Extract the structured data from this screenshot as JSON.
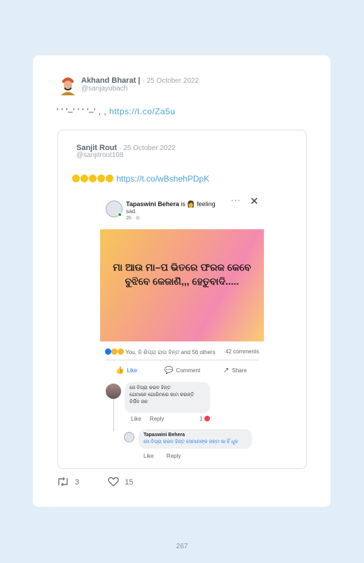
{
  "tweet": {
    "author_name": "Akhand Bharat |",
    "date": "· 25 October 2022",
    "handle": "@sanjayubach",
    "text": "' ' '–' ' ' '–' , ,",
    "link": "https://t.co/Za5u",
    "stats": {
      "retweets": "3",
      "likes": "15"
    }
  },
  "quoted": {
    "author_name": "Sanjit Rout",
    "date": "· 25 October 2022",
    "handle": "@sanjitrout108",
    "emoji_count": 5,
    "link": "https://t.co/wBshehPDpK"
  },
  "screenshot": {
    "poster_name": "Tapaswini Behera",
    "poster_activity": "is 👩 feeling",
    "poster_feeling": "sad.",
    "post_time": "2h · ⊙",
    "more_label": "···",
    "close_label": "✕",
    "banner_text": "ମା ଆଉ ମା–ପ ଭିତରେ ଫରକ କେବେ ବୁଝିବେ କେଜାଣି,,, ହେତୁବାଦି.....",
    "reactions_text": "You, ଜି ଶିପ୍ରା ରାଉ ହିନ୍ତ and 56 others",
    "comments_count": "42 comments",
    "like_label": "Like",
    "comment_label": "Comment",
    "share_label": "Share",
    "comment": {
      "text_line1": "ଜେ ବିପ୍ରା କରବ ହିନ୍ତ",
      "text_line2": "ଯେମାନେ ଗୋରିମରେ କାମ କରନ୍ତି",
      "text_line3": "ବିର୍ଜିବ ଜନ",
      "like_label": "Like",
      "reply_label": "Reply",
      "reaction_count": "1"
    },
    "reply": {
      "author": "Tapaswini Behera",
      "text": "ଜେ ବିପ୍ରା କରବ ହିନ୍ତ ସେମାନଙ୍କ ଜନ୍ମ କା ହିଁ ଧୂଳ",
      "like_label": "Like",
      "reply_label": "Reply"
    }
  },
  "page_number": "267",
  "colors": {
    "background": "#e2eef7",
    "link": "#4ba3dd",
    "facebook_blue": "#1877f2"
  }
}
